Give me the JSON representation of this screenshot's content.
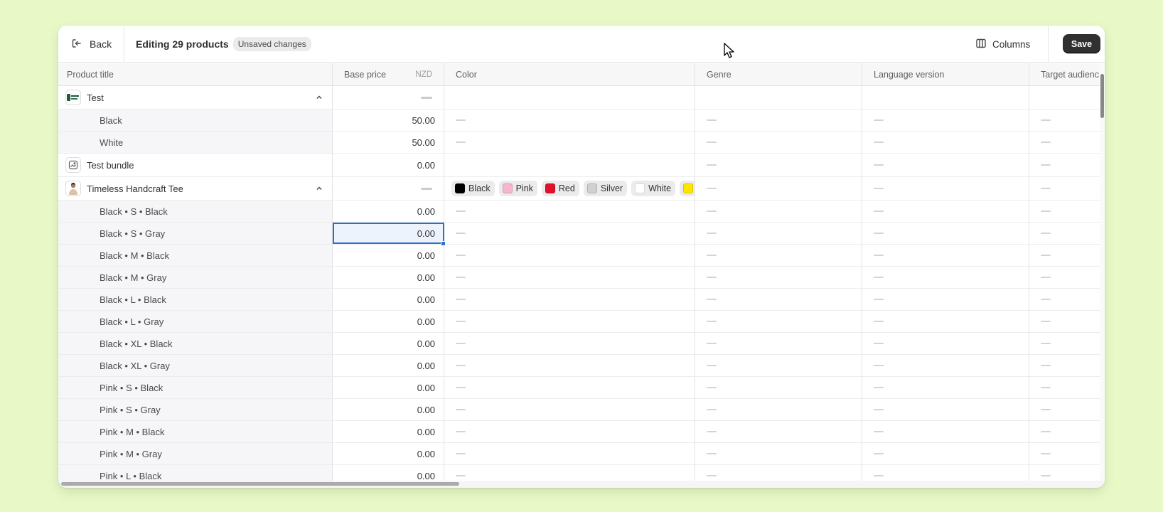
{
  "topbar": {
    "back_label": "Back",
    "title": "Editing 29 products",
    "badge": "Unsaved changes",
    "columns_label": "Columns",
    "save_label": "Save"
  },
  "columns": {
    "product_title": "Product title",
    "base_price": "Base price",
    "currency": "NZD",
    "color": "Color",
    "genre": "Genre",
    "language_version": "Language version",
    "target_audience": "Target audienc"
  },
  "rows": {
    "test": {
      "title": "Test"
    },
    "test_black": {
      "title": "Black",
      "price": "50.00"
    },
    "test_white": {
      "title": "White",
      "price": "50.00"
    },
    "bundle": {
      "title": "Test bundle",
      "price": "0.00"
    },
    "tee": {
      "title": "Timeless Handcraft Tee"
    },
    "v1": {
      "title": "Black • S • Black",
      "price": "0.00"
    },
    "v2": {
      "title": "Black • S • Gray",
      "price": "0.00"
    },
    "v3": {
      "title": "Black • M • Black",
      "price": "0.00"
    },
    "v4": {
      "title": "Black • M • Gray",
      "price": "0.00"
    },
    "v5": {
      "title": "Black • L • Black",
      "price": "0.00"
    },
    "v6": {
      "title": "Black • L • Gray",
      "price": "0.00"
    },
    "v7": {
      "title": "Black • XL • Black",
      "price": "0.00"
    },
    "v8": {
      "title": "Black • XL • Gray",
      "price": "0.00"
    },
    "v9": {
      "title": "Pink • S • Black",
      "price": "0.00"
    },
    "v10": {
      "title": "Pink • S • Gray",
      "price": "0.00"
    },
    "v11": {
      "title": "Pink • M • Black",
      "price": "0.00"
    },
    "v12": {
      "title": "Pink • M • Gray",
      "price": "0.00"
    },
    "v13": {
      "title": "Pink • L • Black",
      "price": "0.00"
    }
  },
  "tee_colors": [
    {
      "label": "Black",
      "swatch": "#000000"
    },
    {
      "label": "Pink",
      "swatch": "#f7b6cf"
    },
    {
      "label": "Red",
      "swatch": "#e0112b"
    },
    {
      "label": "Silver",
      "swatch": "#d0d0d0"
    },
    {
      "label": "White",
      "swatch": "#ffffff"
    },
    {
      "label": "Y",
      "swatch": "#ffe600"
    }
  ],
  "colors": {
    "background": "#e8f8c6",
    "selection": "#2c6ecb",
    "save_button": "#303030"
  }
}
